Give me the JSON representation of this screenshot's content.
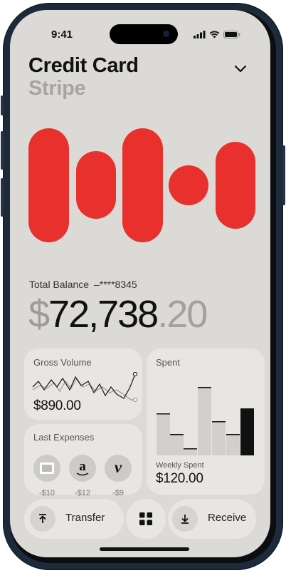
{
  "status_bar": {
    "time": "9:41"
  },
  "header": {
    "title": "Credit Card",
    "subtitle": "Stripe",
    "dropdown_icon": "chevron-down-icon"
  },
  "balance": {
    "label": "Total Balance",
    "account_mask": "–****8345",
    "currency": "$",
    "integer": "72,738",
    "decimal": ".20"
  },
  "gross_volume": {
    "title": "Gross Volume",
    "value": "$890.00"
  },
  "spent": {
    "title": "Spent",
    "sublabel": "Weekly Spent",
    "value": "$120.00"
  },
  "last_expenses": {
    "title": "Last Expenses",
    "items": [
      {
        "icon": "uber-logo-icon",
        "amount": "-$10"
      },
      {
        "icon": "amazon-logo-icon",
        "amount": "-$12",
        "glyph": "a"
      },
      {
        "icon": "vimeo-logo-icon",
        "amount": "-$9",
        "glyph": "v"
      }
    ]
  },
  "dock": {
    "transfer_label": "Transfer",
    "receive_label": "Receive",
    "menu_icon": "grid-icon"
  },
  "colors": {
    "accent_red": "#e8302c",
    "background": "#dcdad6",
    "card": "#e8e6e2"
  }
}
